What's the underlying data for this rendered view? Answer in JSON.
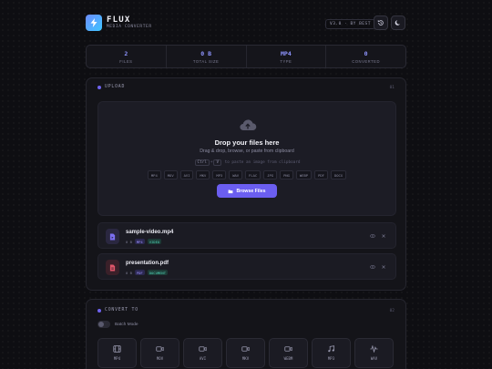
{
  "header": {
    "brand": "FLUX",
    "subtitle": "MEDIA CONVERTER",
    "version": "V3.0 · BY BEST",
    "history_icon": "history-icon",
    "theme_icon": "moon-icon"
  },
  "stats": [
    {
      "value": "2",
      "label": "FILES"
    },
    {
      "value": "0 B",
      "label": "TOTAL SIZE"
    },
    {
      "value": "MP4",
      "label": "TYPE"
    },
    {
      "value": "0",
      "label": "CONVERTED"
    }
  ],
  "upload": {
    "title": "UPLOAD",
    "number": "01",
    "drop_title": "Drop your files here",
    "drop_sub": "Drag & drop, browse, or paste from clipboard",
    "paste_prefix": "",
    "paste_key1": "Ctrl",
    "paste_plus": "+",
    "paste_key2": "V",
    "paste_suffix": "to paste an image from clipboard",
    "formats": [
      "MP4",
      "MOV",
      "AVI",
      "MKV",
      "MP3",
      "WAV",
      "FLAC",
      "JPG",
      "PNG",
      "WEBP",
      "PDF",
      "DOCX"
    ],
    "browse_label": "Browse Files"
  },
  "files": [
    {
      "name": "sample-video.mp4",
      "size": "0 B",
      "ext": "MP4",
      "category": "VIDEO",
      "color": "#7c6ff2"
    },
    {
      "name": "presentation.pdf",
      "size": "0 B",
      "ext": "PDF",
      "category": "DOCUMENT",
      "color": "#e0566a"
    }
  ],
  "convert": {
    "title": "CONVERT TO",
    "number": "02",
    "batch_label": "Batch Mode",
    "targets": [
      {
        "label": "MP4",
        "icon": "film-icon"
      },
      {
        "label": "MOV",
        "icon": "video-camera-icon"
      },
      {
        "label": "AVI",
        "icon": "video-camera-icon"
      },
      {
        "label": "MKV",
        "icon": "video-camera-icon"
      },
      {
        "label": "WEBM",
        "icon": "video-camera-icon"
      },
      {
        "label": "MP3",
        "icon": "music-note-icon"
      },
      {
        "label": "WAV",
        "icon": "waveform-icon"
      }
    ]
  },
  "colors": {
    "accent": "#6b5ef0",
    "stat_value": "#8f95ff",
    "background": "#0e0e12"
  }
}
